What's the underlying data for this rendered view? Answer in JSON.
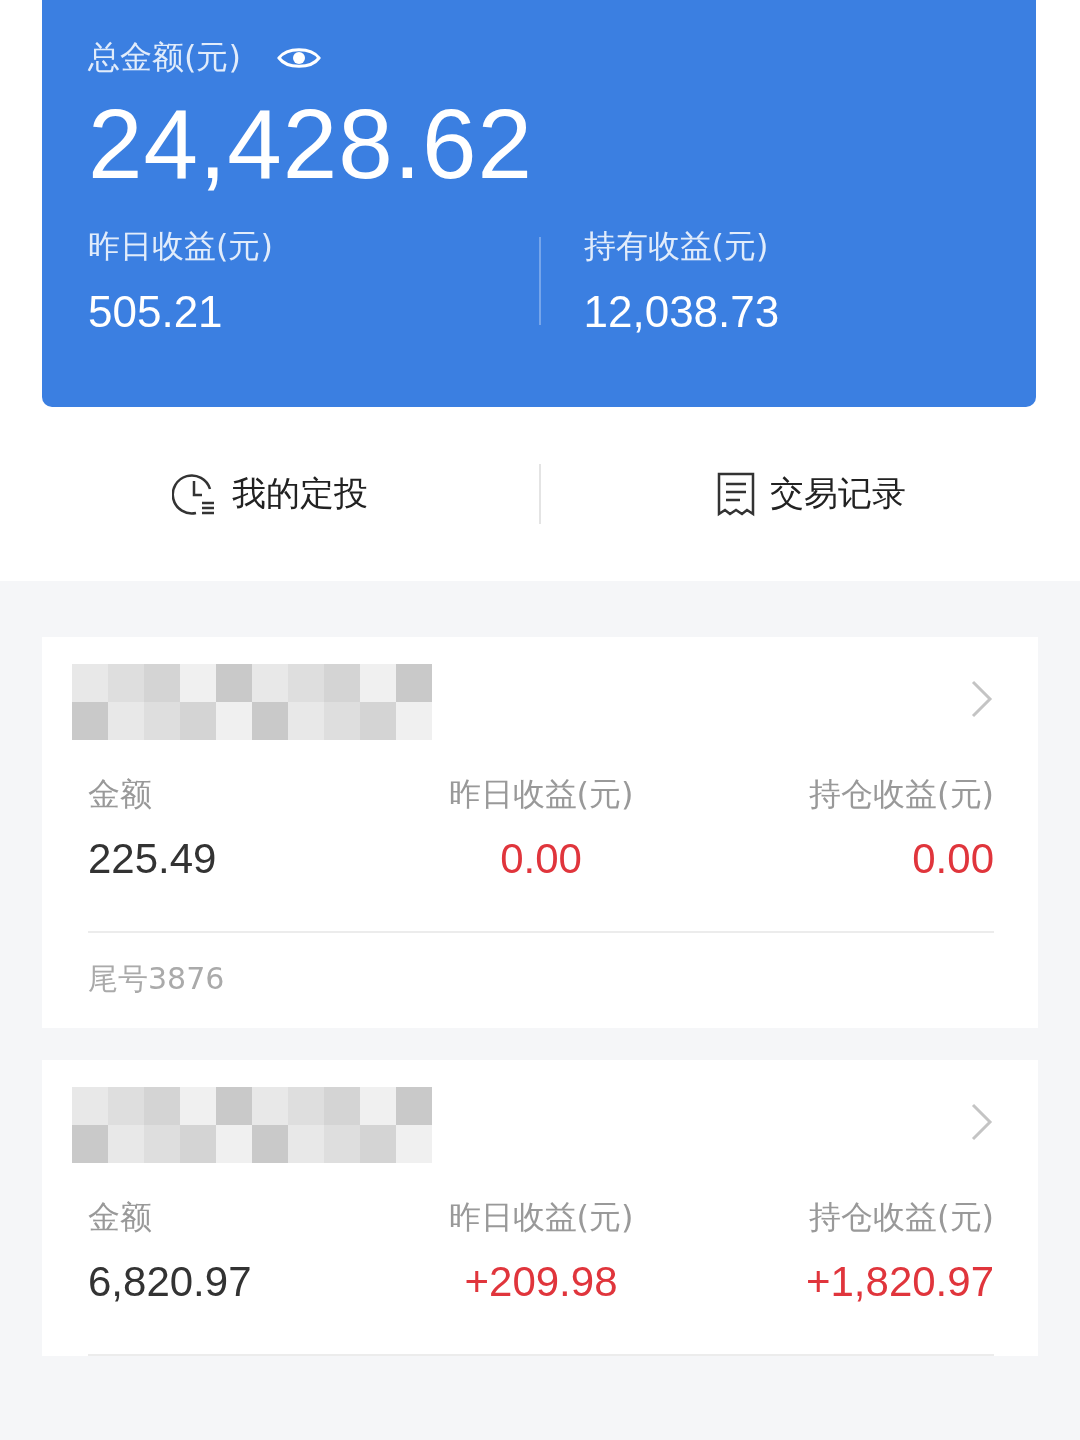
{
  "summary": {
    "label": "总金额(元)",
    "total": "24,428.62",
    "stats": [
      {
        "label": "昨日收益(元)",
        "value": "505.21"
      },
      {
        "label": "持有收益(元)",
        "value": "12,038.73"
      }
    ]
  },
  "actions": [
    {
      "kind": "clock",
      "label": "我的定投"
    },
    {
      "kind": "receipt",
      "label": "交易记录"
    }
  ],
  "funds": [
    {
      "amount_label": "金额",
      "amount": "225.49",
      "yesterday_label": "昨日收益(元)",
      "yesterday": "0.00",
      "holding_label": "持仓收益(元)",
      "holding": "0.00",
      "footer": "尾号3876"
    },
    {
      "amount_label": "金额",
      "amount": "6,820.97",
      "yesterday_label": "昨日收益(元)",
      "yesterday": "+209.98",
      "holding_label": "持仓收益(元)",
      "holding": "+1,820.97"
    }
  ]
}
